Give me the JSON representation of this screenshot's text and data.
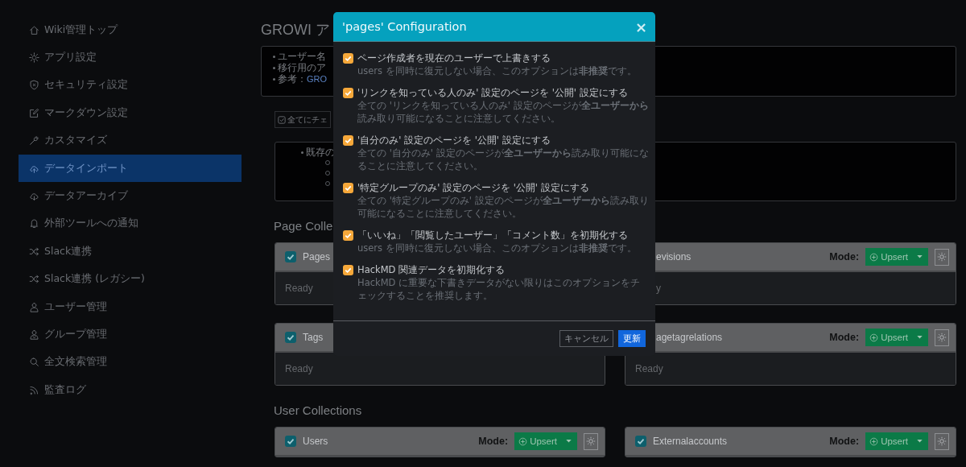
{
  "sidebar": {
    "items": [
      {
        "label": "Wiki管理トップ",
        "selected": false
      },
      {
        "label": "アプリ設定",
        "selected": false
      },
      {
        "label": "セキュリティ設定",
        "selected": false
      },
      {
        "label": "マークダウン設定",
        "selected": false
      },
      {
        "label": "カスタマイズ",
        "selected": false
      },
      {
        "label": "データインポート",
        "selected": true
      },
      {
        "label": "データアーカイブ",
        "selected": false
      },
      {
        "label": "外部ツールへの通知",
        "selected": false
      },
      {
        "label": "Slack連携",
        "selected": false
      },
      {
        "label": "Slack連携 (レガシー)",
        "selected": false
      },
      {
        "label": "ユーザー管理",
        "selected": false
      },
      {
        "label": "グループ管理",
        "selected": false
      },
      {
        "label": "全文検索管理",
        "selected": false
      },
      {
        "label": "監査ログ",
        "selected": false
      }
    ]
  },
  "main": {
    "title": "GROWI ア",
    "info_items": [
      {
        "text": "ユーザー名"
      },
      {
        "text": "移行用のア"
      },
      {
        "text": "参考：",
        "link": "GRO"
      }
    ],
    "check_all_button": "全てにチェ",
    "notes": {
      "items": [
        {
          "text": "既存の",
          "sub_items": [
            {
              "kind": "circle"
            },
            {
              "kind": "circle"
            },
            {
              "kind": "circle"
            }
          ]
        }
      ]
    },
    "page_collections": {
      "heading": "Page Colle",
      "cards": [
        {
          "title": "Pages",
          "checked": true,
          "status": "Ready"
        },
        {
          "title": "evisions",
          "status": "y",
          "mode_label": "Mode:",
          "mode": "Upsert"
        },
        {
          "title": "Tags",
          "checked": true,
          "status": "Ready"
        },
        {
          "title": "agetagrelations",
          "status": "Ready",
          "mode_label": "Mode:",
          "mode": "Upsert"
        }
      ]
    },
    "user_collections": {
      "heading": "User Collections",
      "cards": [
        {
          "title": "Users",
          "checked": true,
          "mode_label": "Mode:",
          "mode": "Upsert"
        },
        {
          "title": "Externalaccounts",
          "checked": true,
          "mode_label": "Mode:",
          "mode": "Upsert"
        }
      ]
    }
  },
  "modal": {
    "title": "'pages' Configuration",
    "close": "×",
    "options": [
      {
        "label": "ページ作成者を現在のユーザーで上書きする",
        "description": "users を同時に復元しない場合、このオプションは**非推奨**です。",
        "checked": true
      },
      {
        "label": "'リンクを知っている人のみ' 設定のページを '公開' 設定にする",
        "description": "全ての 'リンクを知っている人のみ' 設定のページが**全ユーザーから**読み取り可能になることに注意してください。",
        "checked": true
      },
      {
        "label": "'自分のみ' 設定のページを '公開' 設定にする",
        "description": "全ての '自分のみ' 設定のページが**全ユーザーから**読み取り可能になることに注意してください。",
        "checked": true
      },
      {
        "label": "'特定グループのみ' 設定のページを '公開' 設定にする",
        "description": "全ての '特定グループのみ' 設定のページが**全ユーザーから**読み取り可能になることに注意してください。",
        "checked": true
      },
      {
        "label": "「いいね」「閲覧したユーザー」「コメント数」を初期化する",
        "description": "users を同時に復元しない場合、このオプションは**非推奨**です。",
        "checked": true
      },
      {
        "label": "HackMD 関連データを初期化する",
        "description": "HackMD に重要な下書きデータがない限りはこのオプションをチェックすることを推奨します。",
        "checked": true
      }
    ],
    "buttons": [
      {
        "label": "キャンセル",
        "kind": "secondary"
      },
      {
        "label": "更新",
        "kind": "primary"
      }
    ]
  }
}
